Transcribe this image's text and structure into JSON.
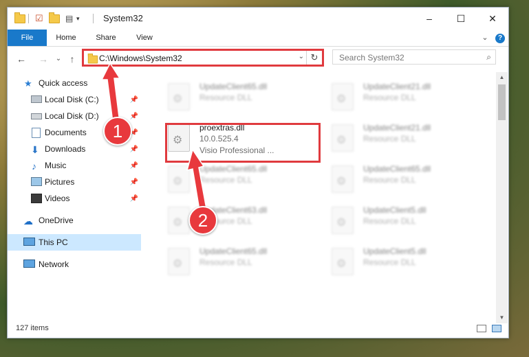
{
  "window": {
    "title": "System32",
    "controls": {
      "minimize": "–",
      "maximize": "☐",
      "close": "✕"
    }
  },
  "ribbon": {
    "tabs": [
      "File",
      "Home",
      "Share",
      "View"
    ],
    "expand_glyph": "⌄",
    "help_glyph": "?"
  },
  "nav": {
    "back": "←",
    "forward": "→",
    "recent": "⌄",
    "up": "↑"
  },
  "address": {
    "path": "C:\\Windows\\System32",
    "dropdown": "⌄",
    "refresh": "↻"
  },
  "search": {
    "placeholder": "Search System32",
    "icon_glyph": "⌕"
  },
  "sidebar": {
    "items": [
      {
        "label": "Quick access",
        "pinned": false,
        "icon": "star-icon"
      },
      {
        "label": "Local Disk (C:)",
        "pinned": true,
        "icon": "drive-icon"
      },
      {
        "label": "Local Disk (D:)",
        "pinned": true,
        "icon": "drive-icon"
      },
      {
        "label": "Documents",
        "pinned": true,
        "icon": "documents-icon"
      },
      {
        "label": "Downloads",
        "pinned": true,
        "icon": "download-icon"
      },
      {
        "label": "Music",
        "pinned": true,
        "icon": "music-icon"
      },
      {
        "label": "Pictures",
        "pinned": true,
        "icon": "pictures-icon"
      },
      {
        "label": "Videos",
        "pinned": true,
        "icon": "video-icon"
      },
      {
        "label": "OneDrive",
        "pinned": false,
        "icon": "cloud-icon"
      },
      {
        "label": "This PC",
        "pinned": false,
        "icon": "computer-icon",
        "selected": true
      },
      {
        "label": "Network",
        "pinned": false,
        "icon": "network-icon"
      }
    ],
    "pin_glyph": "📌"
  },
  "files": {
    "left_column": [
      {
        "name": "UpdateClient65.dll",
        "type": "Resource DLL",
        "blurred": true
      },
      {
        "name": "proextras.dll",
        "version": "10.0.525.4",
        "desc": "Visio Professional ...",
        "blurred": false
      },
      {
        "name": "UpdateClient65.dll",
        "type": "Resource DLL",
        "blurred": true
      },
      {
        "name": "UpdateClient63.dll",
        "type": "Resource DLL",
        "blurred": true
      },
      {
        "name": "UpdateClient65.dll",
        "type": "Resource DLL",
        "blurred": true
      }
    ],
    "right_column": [
      {
        "name": "UpdateClient21.dll",
        "type": "Resource DLL"
      },
      {
        "name": "UpdateClient21.dll",
        "type": "Resource DLL"
      },
      {
        "name": "UpdateClient65.dll",
        "type": "Resource DLL"
      },
      {
        "name": "UpdateClient5.dll",
        "type": "Resource DLL"
      },
      {
        "name": "UpdateClient5.dll",
        "type": "Resource DLL"
      }
    ]
  },
  "status": {
    "count": "127 items"
  },
  "annotations": {
    "marker_1": "1",
    "marker_2": "2",
    "color": "#e03a3e"
  }
}
